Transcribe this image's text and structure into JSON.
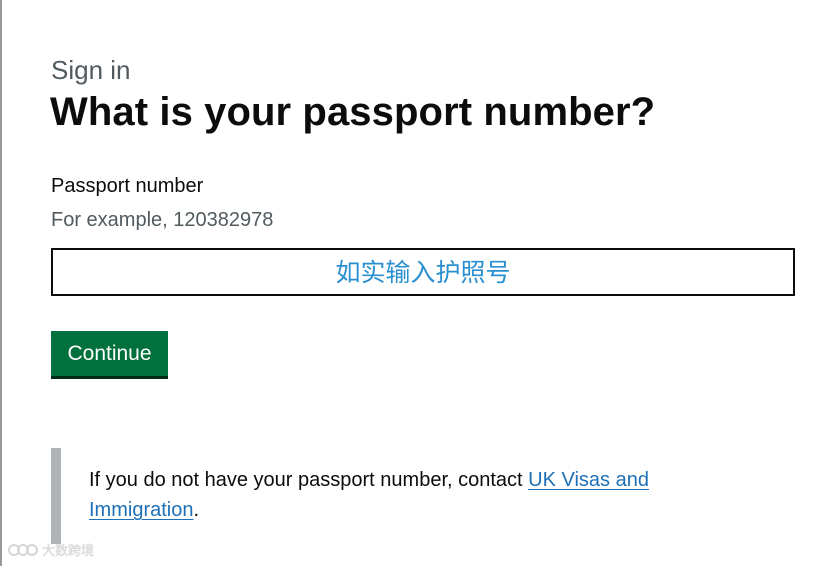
{
  "page": {
    "caption": "Sign in",
    "title": "What is your passport number?"
  },
  "form": {
    "label": "Passport number",
    "hint": "For example, 120382978",
    "placeholder": "如实输入护照号",
    "value": ""
  },
  "actions": {
    "continue_label": "Continue"
  },
  "inset": {
    "text_before": "If you do not have your passport number, contact ",
    "link_text": "UK Visas and Immigration",
    "text_after": "."
  },
  "watermark": {
    "text": "大数跨境"
  },
  "colors": {
    "button": "#00703c",
    "link": "#1d70b8",
    "inset_border": "#b1b4b6",
    "placeholder": "#2a8fd0"
  }
}
